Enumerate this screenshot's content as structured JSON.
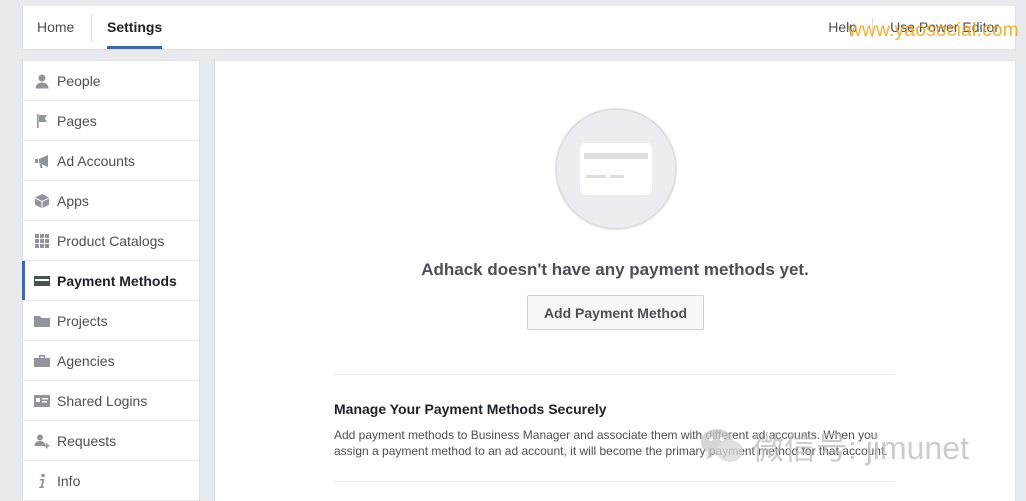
{
  "topnav": {
    "home": "Home",
    "settings": "Settings",
    "help": "Help",
    "power_editor": "Use Power Editor"
  },
  "sidebar": {
    "items": [
      {
        "label": "People",
        "icon": "person-icon"
      },
      {
        "label": "Pages",
        "icon": "flag-icon"
      },
      {
        "label": "Ad Accounts",
        "icon": "megaphone-icon"
      },
      {
        "label": "Apps",
        "icon": "cube-icon"
      },
      {
        "label": "Product Catalogs",
        "icon": "grid-icon"
      },
      {
        "label": "Payment Methods",
        "icon": "credit-card-icon",
        "active": true
      },
      {
        "label": "Projects",
        "icon": "folder-icon"
      },
      {
        "label": "Agencies",
        "icon": "briefcase-icon"
      },
      {
        "label": "Shared Logins",
        "icon": "id-card-icon"
      },
      {
        "label": "Requests",
        "icon": "add-person-icon"
      },
      {
        "label": "Info",
        "icon": "info-icon"
      }
    ]
  },
  "main": {
    "empty_title": "Adhack doesn't have any payment methods yet.",
    "add_button": "Add Payment Method",
    "section_title": "Manage Your Payment Methods Securely",
    "section_body": "Add payment methods to Business Manager and associate them with different ad accounts. When you assign a payment method to an ad account, it will become the primary payment method for that account."
  },
  "watermarks": {
    "url": "www.yaosocial.com",
    "wechat": "微信号: jimunet"
  },
  "colors": {
    "accent": "#4267b2",
    "watermark_orange": "#f6a81a"
  }
}
